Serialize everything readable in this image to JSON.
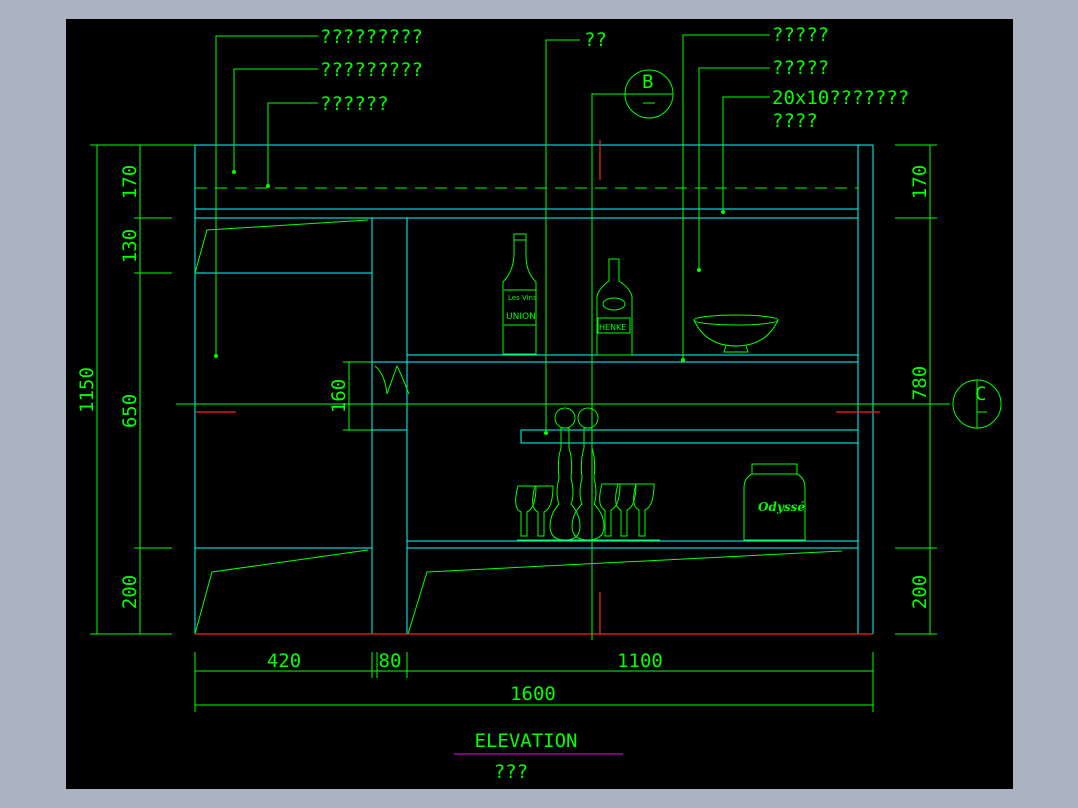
{
  "drawing": {
    "title": "ELEVATION",
    "subtitle": "???",
    "section_b": "B",
    "section_c": "C"
  },
  "labels": {
    "top1": "?????????",
    "top2": "?????????",
    "top3": "??????",
    "mid": "??",
    "right1": "?????",
    "right2": "?????",
    "right3a": "20x10???????",
    "right3b": "????"
  },
  "bottles": {
    "wine_brand": "Les Vins",
    "wine_name": "UNION",
    "whisky_name": "HENKE",
    "jar_name": "Odyssé"
  },
  "dimensions": {
    "left_outer": "1150",
    "left_170": "170",
    "left_130": "130",
    "left_650": "650",
    "left_200": "200",
    "left_160": "160",
    "right_170": "170",
    "right_780": "780",
    "right_200": "200",
    "bottom_420": "420",
    "bottom_80": "80",
    "bottom_1100": "1100",
    "bottom_1600": "1600"
  }
}
